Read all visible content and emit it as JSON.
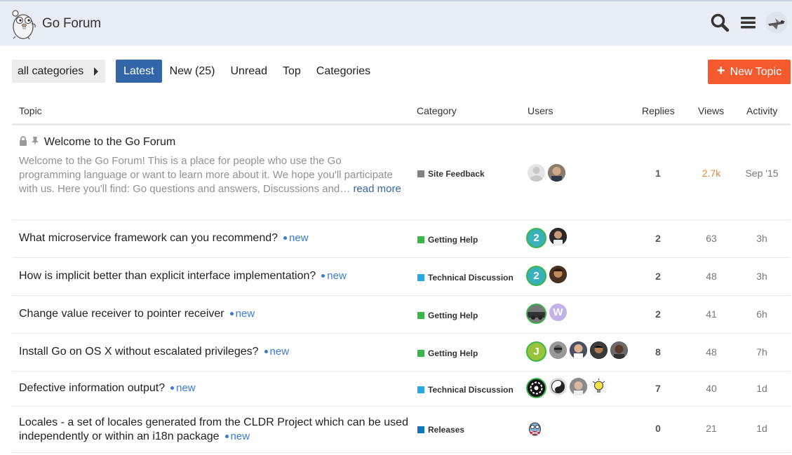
{
  "header": {
    "site_name": "Go Forum",
    "icons": [
      "search-icon",
      "hamburger-menu-icon",
      "user-avatar"
    ]
  },
  "nav": {
    "category_dropdown": "all categories",
    "tabs": [
      {
        "label": "Latest",
        "active": true
      },
      {
        "label": "New (25)",
        "active": false
      },
      {
        "label": "Unread",
        "active": false
      },
      {
        "label": "Top",
        "active": false
      },
      {
        "label": "Categories",
        "active": false
      }
    ],
    "new_topic": "New Topic"
  },
  "table": {
    "headers": {
      "topic": "Topic",
      "category": "Category",
      "users": "Users",
      "replies": "Replies",
      "views": "Views",
      "activity": "Activity"
    },
    "rows": [
      {
        "title": "Welcome to the Go Forum",
        "excerpt": "Welcome to the Go Forum! This is a place for people who use the Go programming language or want to learn more about it. We hope you'll participate with us. Here you'll find: Go questions and answers, Discussions and…",
        "read_more": "read more",
        "category": "Site Feedback",
        "replies": "1",
        "views": "2.7k",
        "activity": "Sep '15"
      },
      {
        "title": "What microservice framework can you recommend?",
        "badge": "new",
        "category": "Getting Help",
        "replies": "2",
        "views": "63",
        "activity": "3h"
      },
      {
        "title": "How is implicit better than explicit interface implementation?",
        "badge": "new",
        "category": "Technical Discussion",
        "replies": "2",
        "views": "48",
        "activity": "3h"
      },
      {
        "title": "Change value receiver to pointer receiver",
        "badge": "new",
        "category": "Getting Help",
        "replies": "2",
        "views": "41",
        "activity": "6h"
      },
      {
        "title": "Install Go on OS X without escalated privileges?",
        "badge": "new",
        "category": "Getting Help",
        "replies": "8",
        "views": "48",
        "activity": "7h"
      },
      {
        "title": "Defective information output?",
        "badge": "new",
        "category": "Technical Discussion",
        "replies": "7",
        "views": "40",
        "activity": "1d"
      },
      {
        "title_line1": "Locales - a set of locales generated from the CLDR Project which can be used",
        "title_line2": "independently or within an i18n package",
        "badge": "new",
        "category": "Releases",
        "replies": "0",
        "views": "21",
        "activity": "1d"
      }
    ]
  },
  "avatar_letters": {
    "two": "2",
    "w": "W",
    "j": "J"
  },
  "colors": {
    "header_bg": "#e8edf5",
    "active_tab": "#3366a8",
    "new_topic": "#f45a2d",
    "new_badge": "#3a7bd5",
    "cat_site_feedback": "#808281",
    "cat_getting_help": "#3ab54a",
    "cat_technical": "#25aae1",
    "cat_releases": "#0e76bd"
  }
}
